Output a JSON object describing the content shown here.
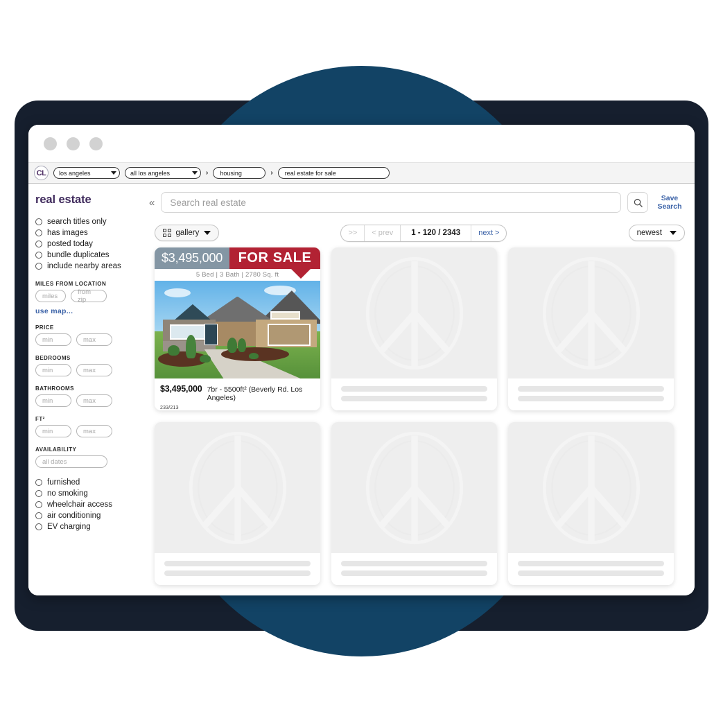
{
  "window": {
    "dots": [
      "close-dot",
      "minimize-dot",
      "maximize-dot"
    ]
  },
  "nav": {
    "logo": "CL",
    "city_select": "los angeles",
    "area_select": "all los angeles",
    "crumb_category": "housing",
    "crumb_subcategory": "real estate for sale",
    "separator": "›"
  },
  "sidebar": {
    "category_title": "real estate",
    "top_filters": [
      {
        "label": "search titles only"
      },
      {
        "label": "has images"
      },
      {
        "label": "posted today"
      },
      {
        "label": "bundle duplicates"
      },
      {
        "label": "include nearby areas"
      }
    ],
    "distance": {
      "label": "MILES FROM LOCATION",
      "miles_placeholder": "miles",
      "zip_placeholder": "from zip",
      "use_map_link": "use map..."
    },
    "ranges": [
      {
        "label": "PRICE",
        "min_placeholder": "min",
        "max_placeholder": "max"
      },
      {
        "label": "BEDROOMS",
        "min_placeholder": "min",
        "max_placeholder": "max"
      },
      {
        "label": "BATHROOMS",
        "min_placeholder": "min",
        "max_placeholder": "max"
      },
      {
        "label": "FT²",
        "min_placeholder": "min",
        "max_placeholder": "max"
      }
    ],
    "availability": {
      "label": "AVAILABILITY",
      "placeholder": "all dates"
    },
    "amenities": [
      {
        "label": "furnished"
      },
      {
        "label": "no smoking"
      },
      {
        "label": "wheelchair access"
      },
      {
        "label": "air conditioning"
      },
      {
        "label": "EV charging"
      }
    ]
  },
  "search": {
    "collapse_icon": "«",
    "placeholder": "Search real estate",
    "value": "",
    "search_icon": "search-icon",
    "save_search_line1": "Save",
    "save_search_line2": "Search"
  },
  "toolbar": {
    "view_mode": "gallery",
    "pager": {
      "first": ">>",
      "prev": "< prev",
      "count": "1 - 120 / 2343",
      "next": "next >"
    },
    "sort": "newest"
  },
  "listings": [
    {
      "type": "listing",
      "banner_price": "$3,495,000",
      "banner_tag": "FOR SALE",
      "banner_specs": "5 Bed | 3 Bath | 2780 Sq. ft",
      "price": "$3,495,000",
      "description": "7br - 5500ft² (Beverly Rd. Los Angeles)",
      "sub": "233/213"
    },
    {
      "type": "placeholder"
    },
    {
      "type": "placeholder"
    },
    {
      "type": "placeholder"
    },
    {
      "type": "placeholder"
    },
    {
      "type": "placeholder"
    }
  ],
  "colors": {
    "brand_purple": "#3f2a5c",
    "link_blue": "#3c63a8",
    "banner_red": "#b22233",
    "banner_slate": "#8496a4",
    "bg_navy": "#161f2e",
    "bg_blue_dark": "#124365",
    "bg_blue_light": "#4fadde"
  }
}
